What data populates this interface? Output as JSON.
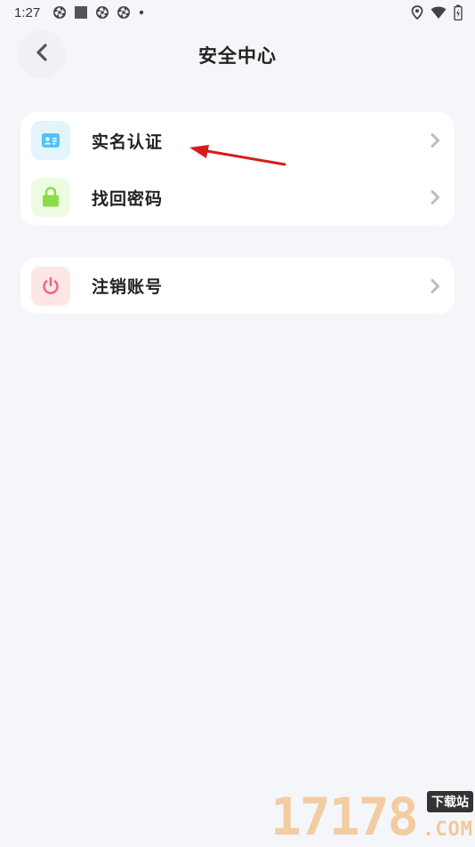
{
  "status_bar": {
    "time": "1:27",
    "left_icons": [
      "shutter-icon",
      "square-icon",
      "shutter-icon",
      "shutter-icon",
      "dot-icon"
    ],
    "right_icons": [
      "location-icon",
      "wifi-icon",
      "battery-icon"
    ]
  },
  "header": {
    "title": "安全中心",
    "back_icon": "chevron-left-icon"
  },
  "sections": [
    {
      "items": [
        {
          "label": "实名认证",
          "icon": "id-card-icon",
          "icon_bg": "#e3f4fd",
          "icon_color": "#4fc3f7"
        },
        {
          "label": "找回密码",
          "icon": "lock-icon",
          "icon_bg": "#eefbe3",
          "icon_color": "#8bdc4a"
        }
      ]
    },
    {
      "items": [
        {
          "label": "注销账号",
          "icon": "power-icon",
          "icon_bg": "#fde6e8",
          "icon_color": "#f06a7a"
        }
      ]
    }
  ],
  "annotation": {
    "type": "arrow",
    "color": "#d71a1a"
  },
  "watermark": {
    "digits": "17178",
    "tag": "下载站",
    "suffix": ".COM"
  },
  "colors": {
    "background": "#f5f6f9",
    "card": "#ffffff",
    "chevron": "#b9bcc3"
  }
}
